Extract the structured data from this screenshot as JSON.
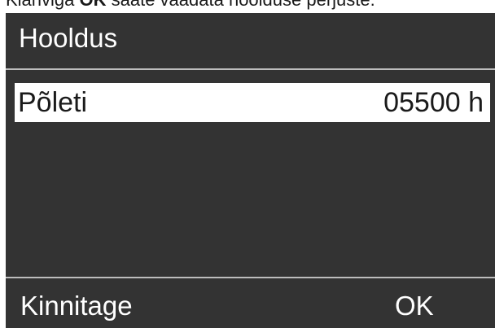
{
  "instruction": {
    "prefix": "Klahviga ",
    "key": "OK",
    "suffix": " saate vaadata hoolduse perjuste."
  },
  "screen": {
    "title": "Hooldus",
    "selected_row": {
      "label": "Põleti",
      "value": "05500 h"
    },
    "softkeys": {
      "left": "Kinnitage",
      "right": "OK"
    }
  },
  "colors": {
    "display_background": "#333333",
    "display_text": "#ffffff",
    "selection_background": "#ffffff",
    "selection_text": "#1a1a1a",
    "divider": "#bdbdbd"
  }
}
